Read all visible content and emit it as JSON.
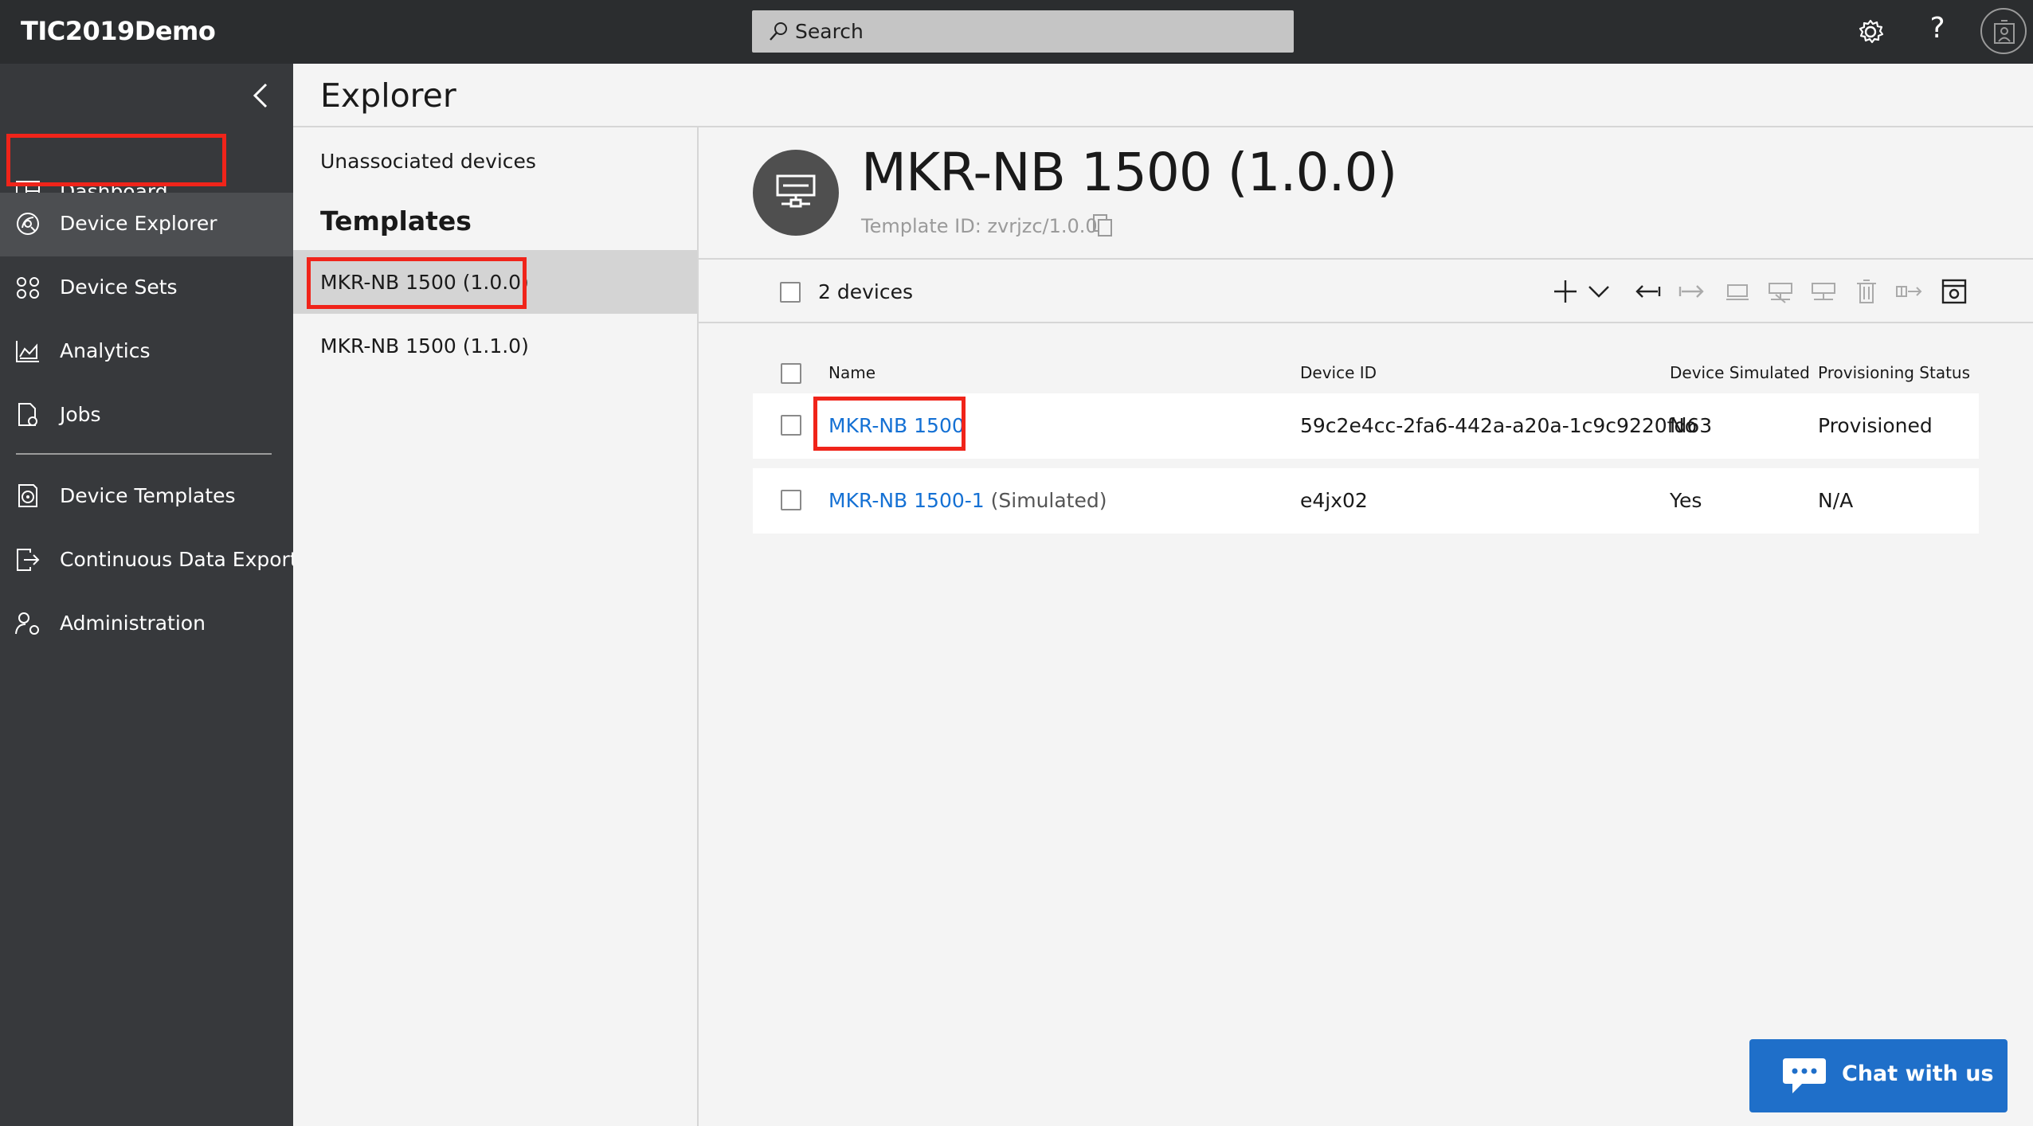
{
  "app": {
    "title": "TIC2019Demo"
  },
  "search": {
    "label": "Search"
  },
  "topbar": {
    "settings_icon": "gear-icon",
    "help_label": "?",
    "avatar_icon": "user-avatar-icon"
  },
  "nav": {
    "items": [
      {
        "label": "Dashboard",
        "icon": "dashboard-icon"
      },
      {
        "label": "Device Explorer",
        "icon": "device-explorer-icon",
        "active": true
      },
      {
        "label": "Device Sets",
        "icon": "device-sets-icon"
      },
      {
        "label": "Analytics",
        "icon": "analytics-icon"
      },
      {
        "label": "Jobs",
        "icon": "jobs-icon"
      },
      {
        "label": "Device Templates",
        "icon": "device-templates-icon"
      },
      {
        "label": "Continuous Data Export",
        "icon": "data-export-icon"
      },
      {
        "label": "Administration",
        "icon": "administration-icon"
      }
    ]
  },
  "explorer": {
    "title": "Explorer",
    "unassociated": "Unassociated devices",
    "templates_heading": "Templates",
    "templates": [
      {
        "label": "MKR-NB 1500 (1.0.0)",
        "selected": true
      },
      {
        "label": "MKR-NB 1500 (1.1.0)",
        "selected": false
      }
    ]
  },
  "detail": {
    "title": "MKR-NB 1500 (1.0.0)",
    "template_id": "Template ID: zvrjzc/1.0.0",
    "device_count": "2 devices",
    "columns": [
      "Name",
      "Device ID",
      "Device Simulated",
      "Provisioning Status"
    ],
    "rows": [
      {
        "name": "MKR-NB 1500",
        "suffix": "",
        "device_id": "59c2e4cc-2fa6-442a-a20a-1c9c9220fd63",
        "simulated": "No",
        "status": "Provisioned"
      },
      {
        "name": "MKR-NB 1500-1",
        "suffix": " (Simulated)",
        "device_id": "e4jx02",
        "simulated": "Yes",
        "status": "N/A"
      }
    ]
  },
  "chat": {
    "label": "Chat with us"
  },
  "colors": {
    "highlight": "#f0241a",
    "link": "#1571d4",
    "chat": "#1f6fc9",
    "nav_bg": "#37393c",
    "topbar_bg": "#2b2d2f"
  }
}
